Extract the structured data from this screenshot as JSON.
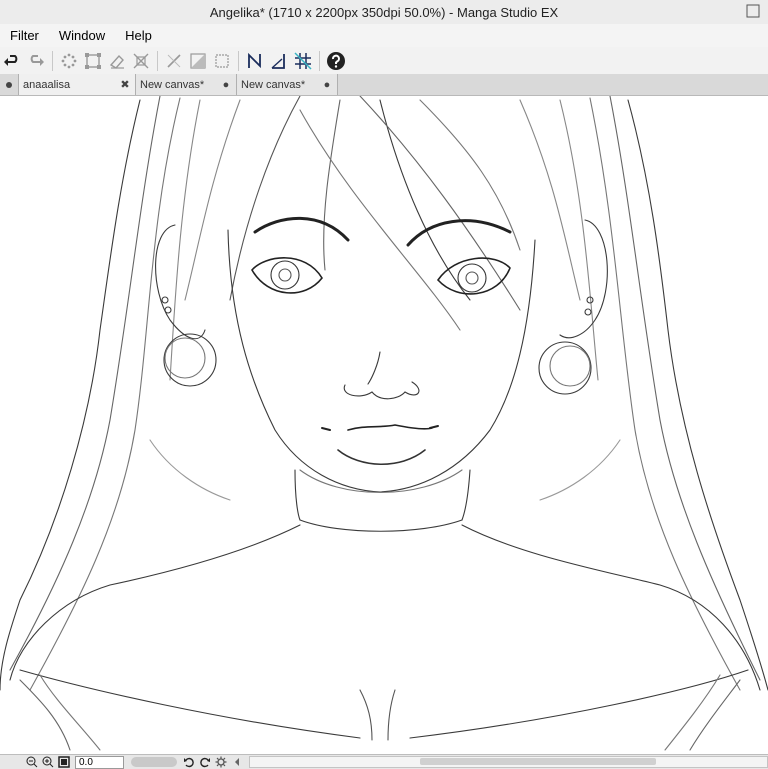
{
  "window": {
    "title": "Angelika* (1710 x 2200px 350dpi 50.0%)  - Manga Studio EX"
  },
  "menubar": {
    "items": [
      "Filter",
      "Window",
      "Help"
    ]
  },
  "toolbar": {
    "icons": [
      "undo-icon",
      "redo-icon",
      "selection-dots-icon",
      "transform-icon",
      "eraser-selection-icon",
      "scale-icon",
      "ruler-toggle-icon",
      "gradient-icon",
      "frame-icon",
      "line-ruler-icon",
      "perspective-ruler-icon",
      "grid-ruler-icon",
      "help-icon"
    ]
  },
  "tabs": [
    {
      "label": "anaaalisa",
      "close": "✖"
    },
    {
      "label": "New canvas*",
      "close": "●"
    },
    {
      "label": "New canvas*",
      "close": "●"
    }
  ],
  "statusbar": {
    "zoom_value": "0.0"
  }
}
